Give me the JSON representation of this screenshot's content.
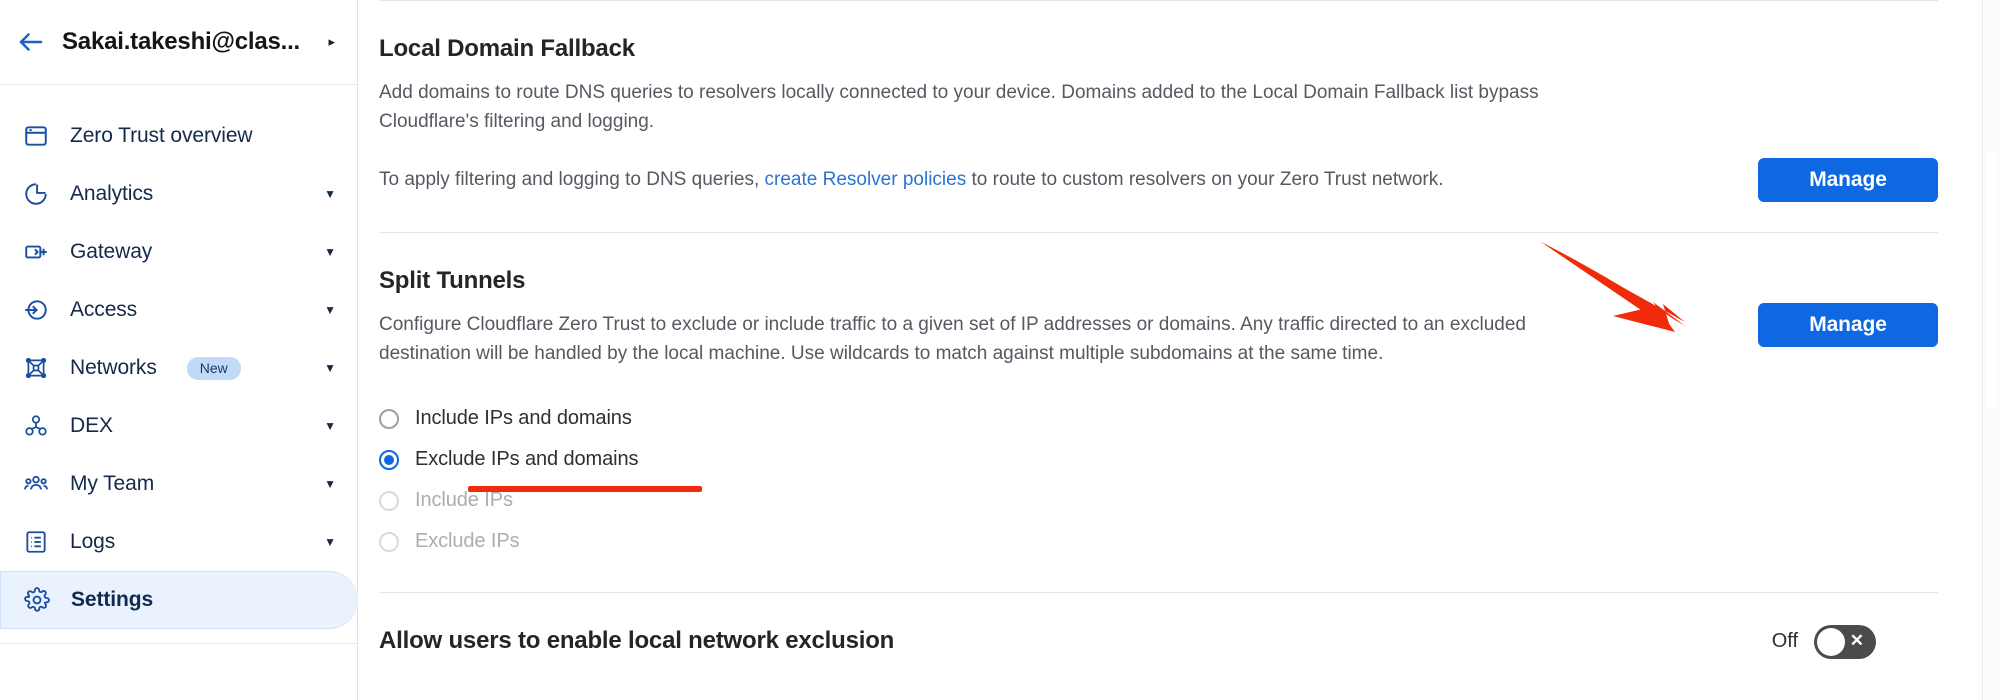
{
  "sidebar": {
    "account": {
      "name": "Sakai.takeshi@clas...",
      "back_icon": "back-arrow-icon",
      "caret_icon": "caret-right-icon"
    },
    "items": [
      {
        "label": "Zero Trust overview",
        "icon": "browser-window-icon",
        "expandable": false,
        "active": false,
        "badge": ""
      },
      {
        "label": "Analytics",
        "icon": "pie-chart-icon",
        "expandable": true,
        "active": false,
        "badge": ""
      },
      {
        "label": "Gateway",
        "icon": "gateway-icon",
        "expandable": true,
        "active": false,
        "badge": ""
      },
      {
        "label": "Access",
        "icon": "access-login-icon",
        "expandable": true,
        "active": false,
        "badge": ""
      },
      {
        "label": "Networks",
        "icon": "network-mesh-icon",
        "expandable": true,
        "active": false,
        "badge": "New"
      },
      {
        "label": "DEX",
        "icon": "dex-nodes-icon",
        "expandable": true,
        "active": false,
        "badge": ""
      },
      {
        "label": "My Team",
        "icon": "people-group-icon",
        "expandable": true,
        "active": false,
        "badge": ""
      },
      {
        "label": "Logs",
        "icon": "logs-list-icon",
        "expandable": true,
        "active": false,
        "badge": ""
      },
      {
        "label": "Settings",
        "icon": "gear-icon",
        "expandable": false,
        "active": true,
        "badge": ""
      }
    ]
  },
  "main": {
    "local_domain_fallback": {
      "title": "Local Domain Fallback",
      "description": "Add domains to route DNS queries to resolvers locally connected to your device. Domains added to the Local Domain Fallback list bypass Cloudflare's filtering and logging.",
      "apply_text_before": "To apply filtering and logging to DNS queries, ",
      "apply_link": "create Resolver policies",
      "apply_text_after": " to route to custom resolvers on your Zero Trust network.",
      "manage_label": "Manage"
    },
    "split_tunnels": {
      "title": "Split Tunnels",
      "description": "Configure Cloudflare Zero Trust to exclude or include traffic to a given set of IP addresses or domains. Any traffic directed to an excluded destination will be handled by the local machine. Use wildcards to match against multiple subdomains at the same time.",
      "manage_label": "Manage",
      "options": [
        {
          "label": "Include IPs and domains",
          "selected": false,
          "disabled": false
        },
        {
          "label": "Exclude IPs and domains",
          "selected": true,
          "disabled": false
        },
        {
          "label": "Include IPs",
          "selected": false,
          "disabled": true
        },
        {
          "label": "Exclude IPs",
          "selected": false,
          "disabled": true
        }
      ]
    },
    "local_network_exclusion": {
      "title": "Allow users to enable local network exclusion",
      "toggle_label": "Off",
      "toggle_state": "off"
    }
  },
  "annotations": {
    "arrow_color": "#ef2b0b",
    "underline_color": "#ef2b0b",
    "arrow_target": "split-tunnels-manage-button",
    "underline_target": "radio-exclude-ips-and-domains"
  },
  "colors": {
    "accent_blue": "#0d68e1",
    "link_blue": "#2c73d2",
    "sidebar_active_bg": "#eaf2fd",
    "badge_bg": "#c3d9f8",
    "annotation_red": "#ef2b0b"
  }
}
